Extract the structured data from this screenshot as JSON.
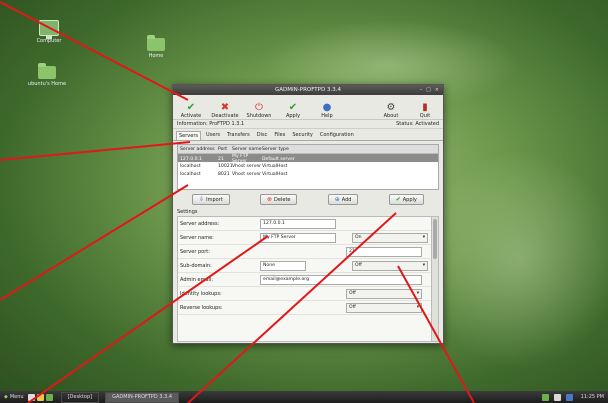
{
  "desktop": {
    "icons": [
      {
        "label": "Computer",
        "icon": "monitor-icon"
      },
      {
        "label": "Home",
        "icon": "folder-icon"
      },
      {
        "label": "ubuntu's Home",
        "icon": "folder-icon"
      }
    ]
  },
  "window": {
    "title": "GADMIN-PROFTPD 3.3.4",
    "controls": [
      "–",
      "□",
      "×"
    ],
    "toolbar": [
      {
        "label": "Activate",
        "icon": "check-icon"
      },
      {
        "label": "Deactivate",
        "icon": "x-icon"
      },
      {
        "label": "Shutdown",
        "icon": "power-icon"
      },
      {
        "label": "Apply",
        "icon": "check-icon"
      },
      {
        "label": "Help",
        "icon": "help-icon"
      },
      {
        "label": "About",
        "icon": "about-icon"
      },
      {
        "label": "Quit",
        "icon": "exit-icon"
      }
    ],
    "info_left": "Information: ProFTPD 1.3.1",
    "info_right": "Status: Activated",
    "tabs": [
      "Servers",
      "Users",
      "Transfers",
      "Disc",
      "Files",
      "Security",
      "Configuration"
    ],
    "server_table": {
      "headers": [
        "Server address",
        "Port",
        "Server name",
        "Server type"
      ],
      "rows": [
        [
          "127.0.0.1",
          "21",
          "My FTP Server",
          "Default server"
        ],
        [
          "localhost",
          "10021",
          "Vhost server",
          "VirtualHost"
        ],
        [
          "localhost",
          "8021",
          "Vhost server",
          "VirtualHost"
        ]
      ]
    },
    "buttons": {
      "import": "Import",
      "delete": "Delete",
      "add": "Add",
      "apply": "Apply"
    },
    "settings": {
      "title": "Settings",
      "fields": [
        {
          "label": "Server address:",
          "value": "127.0.0.1"
        },
        {
          "label": "Server name:",
          "value": "My FTP Server",
          "combo": "On"
        },
        {
          "label": "Server port:",
          "value": "21"
        },
        {
          "label": "Sub-domain:",
          "value": "None",
          "combo": "Off"
        },
        {
          "label": "Admin email:",
          "value": "email@example.org"
        },
        {
          "label": "Identity lookups:",
          "combo": "Off"
        },
        {
          "label": "Reverse lookups:",
          "combo": "Off"
        }
      ]
    }
  },
  "taskbar": {
    "menu": "Menu",
    "tasks": [
      "[Desktop]",
      "GADMIN-PROFTPD 3.3.4"
    ],
    "clock": "11:25 PM"
  },
  "colors": {
    "callout": "#e01818",
    "selected_row": "#8c8c88",
    "titlebar": "#3c3c3a"
  }
}
